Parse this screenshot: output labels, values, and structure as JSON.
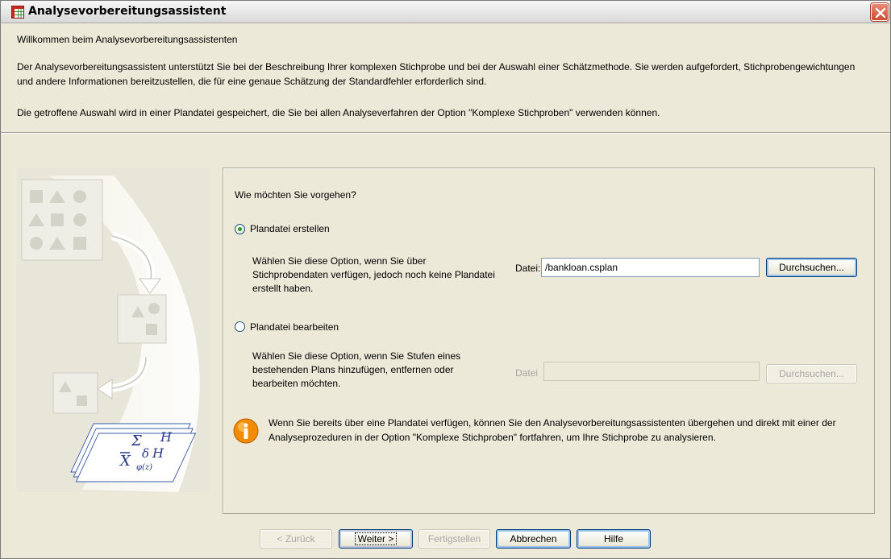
{
  "window": {
    "title": "Analysevorbereitungsassistent"
  },
  "intro": {
    "welcome": "Willkommen beim Analysevorbereitungsassistenten",
    "description": "Der Analysevorbereitungsassistent unterstützt Sie bei der Beschreibung Ihrer komplexen Stichprobe und bei der Auswahl einer Schätzmethode. Sie werden aufgefordert, Stichprobengewichtungen und andere Informationen bereitzustellen, die für eine genaue Schätzung der Standardfehler erforderlich sind.",
    "plan_note": "Die getroffene Auswahl wird in einer Plandatei gespeichert, die Sie bei allen Analyseverfahren der Option \"Komplexe Stichproben\" verwenden können."
  },
  "illustration": {
    "greek_sigma": "Σ",
    "greek_H0": "H",
    "greek_delta": "δ",
    "greek_H1": "H",
    "greek_xbar": "X",
    "greek_phi": "φ(z)"
  },
  "options": {
    "question": "Wie möchten Sie vorgehen?",
    "create": {
      "label": "Plandatei erstellen",
      "selected": true,
      "description": "Wählen Sie diese Option, wenn Sie über Stichprobendaten verfügen, jedoch noch keine Plandatei erstellt haben.",
      "file_label": "Datei:",
      "file_value": "/bankloan.csplan",
      "browse_label": "Durchsuchen..."
    },
    "edit": {
      "label": "Plandatei bearbeiten",
      "selected": false,
      "description": "Wählen Sie diese Option, wenn Sie Stufen eines bestehenden Plans hinzufügen, entfernen oder bearbeiten möchten.",
      "file_label": "Datei",
      "file_value": "",
      "browse_label": "Durchsuchen..."
    },
    "info": "Wenn Sie bereits über eine Plandatei verfügen, können Sie den Analysevorbereitungsassistenten übergehen und direkt mit einer der Analyseprozeduren in der Option \"Komplexe Stichproben\" fortfahren, um Ihre Stichprobe zu analysieren."
  },
  "buttons": {
    "back": "< Zurück",
    "next": "Weiter >",
    "finish": "Fertigstellen",
    "cancel": "Abbrechen",
    "help": "Hilfe"
  },
  "icons": {
    "title": "spss-grid-icon",
    "close": "close-icon",
    "info": "info-icon"
  },
  "colors": {
    "window_bg": "#ece9d8",
    "close_red": "#cf4a2e",
    "radio_green": "#21a121",
    "info_orange": "#f28b00"
  }
}
